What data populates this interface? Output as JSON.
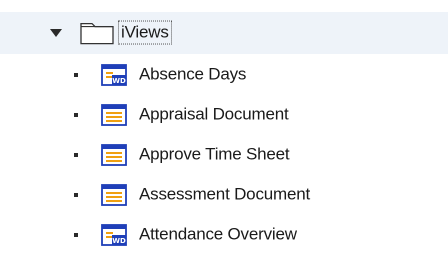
{
  "tree": {
    "root": {
      "label": "iViews",
      "expanded": true,
      "icon": "folder-open-icon",
      "expander_icon": "triangle-down-icon"
    },
    "items": [
      {
        "label": "Absence Days",
        "icon": "iview-wd-icon"
      },
      {
        "label": "Appraisal Document",
        "icon": "iview-icon"
      },
      {
        "label": "Approve Time Sheet",
        "icon": "iview-icon"
      },
      {
        "label": "Assessment Document",
        "icon": "iview-icon"
      },
      {
        "label": "Attendance Overview",
        "icon": "iview-wd-icon"
      }
    ]
  },
  "colors": {
    "selection_background": "#eef3f9",
    "icon_blue": "#1f3fb8",
    "icon_orange": "#f0a010",
    "text": "#1a1a1a"
  }
}
